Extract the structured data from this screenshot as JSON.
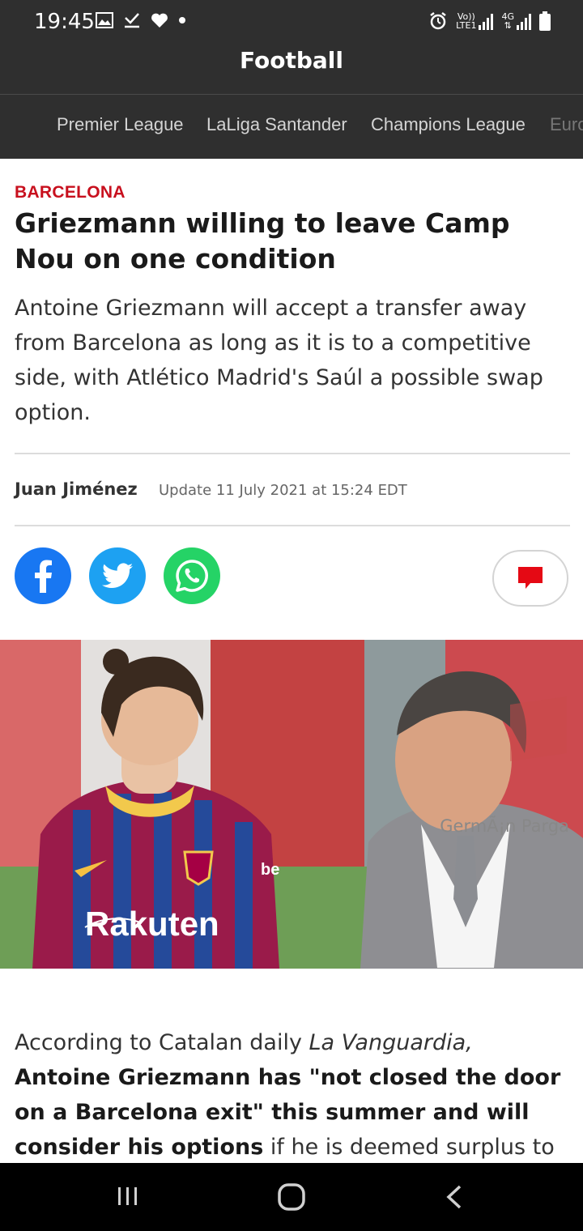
{
  "status_bar": {
    "time": "19:45",
    "left_icons": [
      "gallery-icon",
      "download-done-icon",
      "heart-icon",
      "dot-icon"
    ],
    "right_icons": [
      "alarm-icon",
      "volte-signal-icon",
      "4g-signal-icon",
      "battery-icon"
    ],
    "volte_label_top": "Vo))",
    "volte_label_bottom": "LTE1",
    "net_label": "4G"
  },
  "header": {
    "title": "Football"
  },
  "tabs": [
    {
      "label": "Premier League"
    },
    {
      "label": "LaLiga Santander"
    },
    {
      "label": "Champions League"
    },
    {
      "label": "Euro"
    }
  ],
  "article": {
    "category": "BARCELONA",
    "headline": "Griezmann willing to leave Camp Nou on one condition",
    "subtitle": "Antoine Griezmann will accept a transfer away from Barcelona as long as it is to a competitive side, with Atlético Madrid's Saúl a possible swap option.",
    "author": "Juan Jiménez",
    "update": "Update 11 July 2021 at 15:24 EDT",
    "photo_credit": "GermÃ¡n Parga",
    "body_intro": "According to Catalan daily ",
    "body_source": "La Vanguardia,",
    "body_strong": "Antoine Griezmann has \"not closed the door on a Barcelona exit\" this summer and will consider his options",
    "body_rest": " if he is deemed surplus to requirements"
  },
  "photo": {
    "shirt_sponsor": "Rakuten",
    "sleeve_text": "be"
  },
  "colors": {
    "bar_bg": "#2f2f2f",
    "category_red": "#c8101e",
    "facebook": "#1877f2",
    "twitter": "#1da1f2",
    "whatsapp": "#25d366",
    "comment_red": "#e50914"
  }
}
